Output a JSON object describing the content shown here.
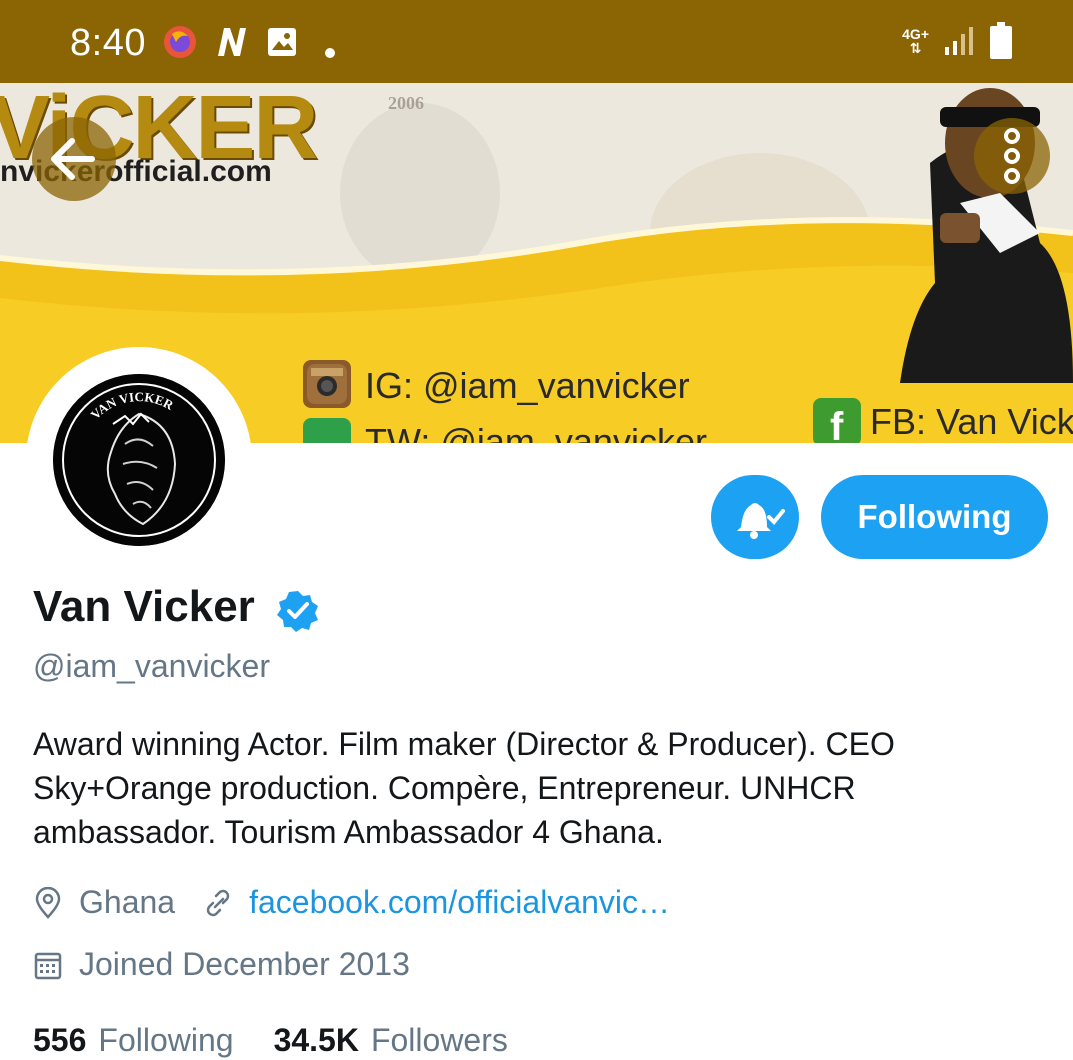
{
  "status_bar": {
    "time": "8:40",
    "network_type": "4G+",
    "notification_icons": [
      "firefox-focus-icon",
      "n-app-icon",
      "image-icon",
      "dot-icon"
    ],
    "background_color": "#8b6404"
  },
  "banner": {
    "title_text": "ViCKER",
    "website": "nvickerofficial.com",
    "year_text": "2006",
    "instagram": "IG: @iam_vanvicker",
    "twitter": "TW: @iam_vanvicker",
    "facebook": "FB: Van Vick",
    "logo_text": "VAN VICKER"
  },
  "profile": {
    "name": "Van Vicker",
    "handle": "@iam_vanvicker",
    "verified": true,
    "bio_lines": [
      "Award winning Actor. Film maker (Director & Producer). CEO",
      "Sky+Orange production. Compère,  Entrepreneur. UNHCR",
      "ambassador. Tourism Ambassador 4 Ghana."
    ],
    "location": "Ghana",
    "website": "facebook.com/officialvanvic…",
    "joined": "Joined December 2013",
    "following_count": "556",
    "following_label": "Following",
    "followers_count": "34.5K",
    "followers_label": "Followers"
  },
  "actions": {
    "follow_button_label": "Following",
    "accent_color": "#1da1f2"
  }
}
